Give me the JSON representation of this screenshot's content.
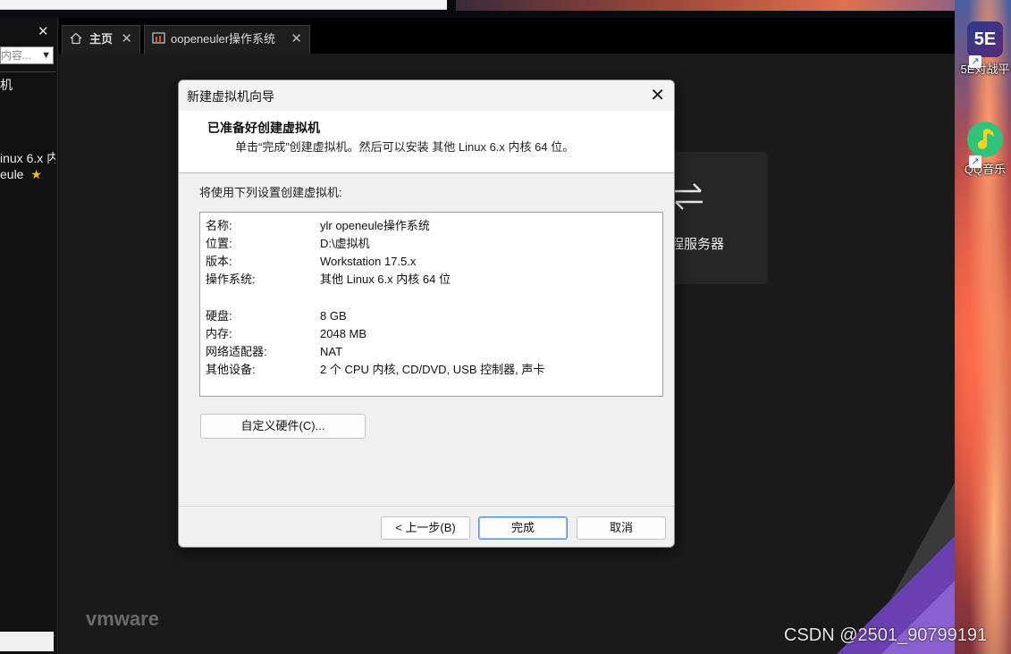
{
  "library": {
    "search_placeholder": "内容...",
    "tree_items": [
      "机",
      "inux 6.x 内",
      "eule"
    ]
  },
  "tabs": [
    {
      "label": "主页",
      "icon": "home-icon"
    },
    {
      "label": "oopeneuler操作系统",
      "icon": "vm-icon"
    }
  ],
  "home": {
    "remote_server_label": "程服务器",
    "logo": "vmware"
  },
  "desktop": {
    "icons": [
      {
        "label": "5E对战平",
        "icon": "5e-platform-icon"
      },
      {
        "label": "QQ音乐",
        "icon": "qq-music-icon"
      }
    ]
  },
  "watermark": "CSDN @2501_90799191",
  "dialog": {
    "title": "新建虚拟机向导",
    "header_title": "已准备好创建虚拟机",
    "header_subtitle": "单击“完成”创建虚拟机。然后可以安装 其他 Linux 6.x 内核 64 位。",
    "intro": "将使用下列设置创建虚拟机:",
    "settings": [
      {
        "key": "名称:",
        "value": "ylr openeule操作系统"
      },
      {
        "key": "位置:",
        "value": "D:\\虚拟机"
      },
      {
        "key": "版本:",
        "value": "Workstation 17.5.x"
      },
      {
        "key": "操作系统:",
        "value": "其他 Linux 6.x 内核 64 位"
      },
      {
        "key": "硬盘:",
        "value": "8 GB"
      },
      {
        "key": "内存:",
        "value": "2048 MB"
      },
      {
        "key": "网络适配器:",
        "value": "NAT"
      },
      {
        "key": "其他设备:",
        "value": "2 个 CPU 内核, CD/DVD, USB 控制器, 声卡"
      }
    ],
    "customize_button": "自定义硬件(C)...",
    "back_button": "< 上一步(B)",
    "finish_button": "完成",
    "cancel_button": "取消"
  }
}
